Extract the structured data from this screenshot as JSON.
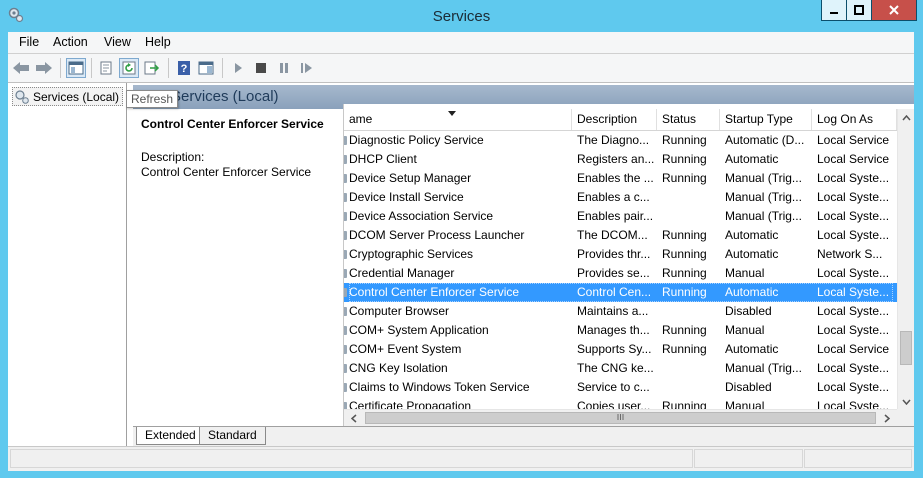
{
  "window": {
    "title": "Services",
    "controls": {
      "minimize": "minimize",
      "maximize": "maximize",
      "close": "close"
    }
  },
  "menu": [
    "File",
    "Action",
    "View",
    "Help"
  ],
  "toolbar": {
    "buttons": [
      "back-arrow-icon",
      "forward-arrow-icon",
      "show-hide-console-tree-icon",
      "properties-icon",
      "refresh-icon",
      "export-list-icon",
      "help-icon",
      "show-action-pane-icon",
      "start-service-icon",
      "stop-service-icon",
      "pause-service-icon",
      "restart-service-icon"
    ],
    "tooltip": "Refresh"
  },
  "tree": {
    "root_label": "Services (Local)"
  },
  "pane": {
    "header": "Services (Local)",
    "selected_service_name": "Control Center Enforcer Service",
    "description_label": "Description:",
    "description_text": "Control Center Enforcer Service"
  },
  "list": {
    "columns": [
      "Name",
      "Description",
      "Status",
      "Startup Type",
      "Log On As"
    ],
    "header_first_visible": "ame",
    "selected_index": 8,
    "rows": [
      [
        "Diagnostic Policy Service",
        "The Diagno...",
        "Running",
        "Automatic (D...",
        "Local Service"
      ],
      [
        "DHCP Client",
        "Registers an...",
        "Running",
        "Automatic",
        "Local Service"
      ],
      [
        "Device Setup Manager",
        "Enables the ...",
        "Running",
        "Manual (Trig...",
        "Local Syste..."
      ],
      [
        "Device Install Service",
        "Enables a c...",
        "",
        "Manual (Trig...",
        "Local Syste..."
      ],
      [
        "Device Association Service",
        "Enables pair...",
        "",
        "Manual (Trig...",
        "Local Syste..."
      ],
      [
        "DCOM Server Process Launcher",
        "The DCOM...",
        "Running",
        "Automatic",
        "Local Syste..."
      ],
      [
        "Cryptographic Services",
        "Provides thr...",
        "Running",
        "Automatic",
        "Network S..."
      ],
      [
        "Credential Manager",
        "Provides se...",
        "Running",
        "Manual",
        "Local Syste..."
      ],
      [
        "Control Center Enforcer Service",
        "Control Cen...",
        "Running",
        "Automatic",
        "Local Syste..."
      ],
      [
        "Computer Browser",
        "Maintains a...",
        "",
        "Disabled",
        "Local Syste..."
      ],
      [
        "COM+ System Application",
        "Manages th...",
        "Running",
        "Manual",
        "Local Syste..."
      ],
      [
        "COM+ Event System",
        "Supports Sy...",
        "Running",
        "Automatic",
        "Local Service"
      ],
      [
        "CNG Key Isolation",
        "The CNG ke...",
        "",
        "Manual (Trig...",
        "Local Syste..."
      ],
      [
        "Claims to Windows Token Service",
        "Service to c...",
        "",
        "Disabled",
        "Local Syste..."
      ],
      [
        "Certificate Propagation",
        "Copies user...",
        "Running",
        "Manual",
        "Local Syste..."
      ]
    ]
  },
  "tabs": [
    "Extended",
    "Standard"
  ],
  "colors": {
    "titlebar": "#5fc9ee",
    "selection": "#3399ff",
    "pane_header": "#98adc5"
  }
}
